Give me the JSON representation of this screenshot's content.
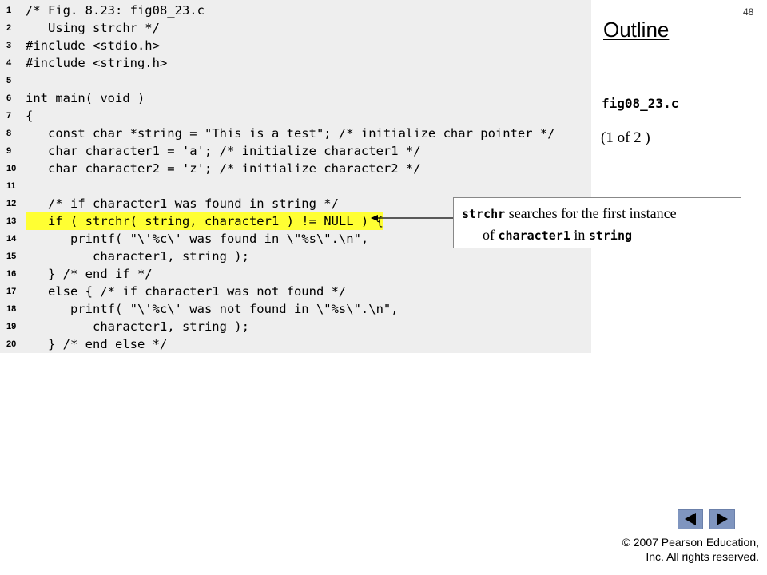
{
  "slide": {
    "page_number": "48",
    "outline_title": "Outline",
    "file_name": "fig08_23.c",
    "page_part": "(1 of 2 )"
  },
  "code": [
    {
      "n": "1",
      "text": "/* Fig. 8.23: fig08_23.c"
    },
    {
      "n": "2",
      "text": "   Using strchr */"
    },
    {
      "n": "3",
      "text": "#include <stdio.h>"
    },
    {
      "n": "4",
      "text": "#include <string.h>"
    },
    {
      "n": "5",
      "text": ""
    },
    {
      "n": "6",
      "text": "int main( void )"
    },
    {
      "n": "7",
      "text": "{"
    },
    {
      "n": "8",
      "text": "   const char *string = \"This is a test\"; /* initialize char pointer */"
    },
    {
      "n": "9",
      "text": "   char character1 = 'a'; /* initialize character1 */"
    },
    {
      "n": "10",
      "text": "   char character2 = 'z'; /* initialize character2 */"
    },
    {
      "n": "11",
      "text": ""
    },
    {
      "n": "12",
      "text": "   /* if character1 was found in string */"
    },
    {
      "n": "13",
      "text": "   if ( strchr( string, character1 ) != NULL ) {"
    },
    {
      "n": "14",
      "text": "      printf( \"\\'%c\\' was found in \\\"%s\\\".\\n\","
    },
    {
      "n": "15",
      "text": "         character1, string );"
    },
    {
      "n": "16",
      "text": "   } /* end if */"
    },
    {
      "n": "17",
      "text": "   else { /* if character1 was not found */"
    },
    {
      "n": "18",
      "text": "      printf( \"\\'%c\\' was not found in \\\"%s\\\".\\n\","
    },
    {
      "n": "19",
      "text": "         character1, string );"
    },
    {
      "n": "20",
      "text": "   } /* end else */"
    }
  ],
  "highlight_line": "13",
  "callout": {
    "code1": "strchr",
    "text1": " searches for the first instance",
    "text2": "of ",
    "code2": "character1",
    "text3": " in ",
    "code3": "string"
  },
  "footer": {
    "copyright_line1": "© 2007 Pearson Education,",
    "copyright_line2": "Inc.  All rights reserved."
  },
  "colors": {
    "code_background": "#eeeeee",
    "highlight": "#ffff33",
    "nav_button": "#7f95bf"
  }
}
